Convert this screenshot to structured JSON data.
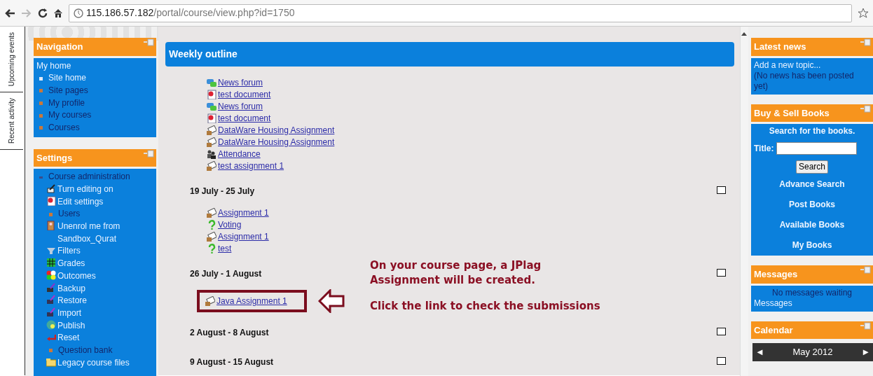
{
  "browser": {
    "url_host": "115.186.57.182",
    "url_path": "/portal/course/view.php?id=1750"
  },
  "side_tabs": [
    {
      "label": "Upcoming events"
    },
    {
      "label": "Recent activity"
    }
  ],
  "navigation": {
    "title": "Navigation",
    "items": [
      {
        "label": "My home",
        "kind": "root"
      },
      {
        "label": "Site home",
        "kind": "leaf"
      },
      {
        "label": "Site pages",
        "kind": "branch"
      },
      {
        "label": "My profile",
        "kind": "branch"
      },
      {
        "label": "My courses",
        "kind": "branch"
      },
      {
        "label": "Courses",
        "kind": "branch"
      }
    ]
  },
  "settings": {
    "title": "Settings",
    "items": [
      {
        "label": "Course administration",
        "kind": "branch",
        "expanded": true,
        "children": [
          {
            "label": "Turn editing on",
            "kind": "editing"
          },
          {
            "label": "Edit settings",
            "kind": "document"
          },
          {
            "label": "Users",
            "kind": "branch"
          },
          {
            "label": "Unenrol me from Sandbox_Qurat",
            "kind": "person"
          },
          {
            "label": "Filters",
            "kind": "filter"
          },
          {
            "label": "Grades",
            "kind": "grades"
          },
          {
            "label": "Outcomes",
            "kind": "outcomes"
          },
          {
            "label": "Backup",
            "kind": "backup"
          },
          {
            "label": "Restore",
            "kind": "restore"
          },
          {
            "label": "Import",
            "kind": "restore"
          },
          {
            "label": "Publish",
            "kind": "publish"
          },
          {
            "label": "Reset",
            "kind": "reset"
          },
          {
            "label": "Question bank",
            "kind": "branch"
          },
          {
            "label": "Legacy course files",
            "kind": "folder"
          }
        ]
      }
    ]
  },
  "course": {
    "title": "Weekly outline",
    "sections": [
      {
        "items": [
          {
            "label": "News forum",
            "kind": "forum",
            "highlighted": false
          },
          {
            "label": "test document",
            "kind": "document",
            "highlighted": false
          },
          {
            "label": "News forum",
            "kind": "forum",
            "highlighted": false
          },
          {
            "label": "test document",
            "kind": "document",
            "highlighted": false
          },
          {
            "label": "DataWare Housing Assignment",
            "kind": "assignment",
            "highlighted": false
          },
          {
            "label": "DataWare Housing Assignment",
            "kind": "assignment",
            "highlighted": false
          },
          {
            "label": "Attendance",
            "kind": "attendance",
            "highlighted": false
          },
          {
            "label": "test assignment 1",
            "kind": "assignment",
            "highlighted": false
          }
        ]
      },
      {
        "title": "19 July - 25 July",
        "items": [
          {
            "label": "Assignment 1",
            "kind": "assignment",
            "highlighted": false
          },
          {
            "label": "Voting",
            "kind": "choice",
            "highlighted": false
          },
          {
            "label": "Assignment 1",
            "kind": "assignment",
            "highlighted": false
          },
          {
            "label": "test",
            "kind": "choice",
            "highlighted": false
          }
        ]
      },
      {
        "title": "26 July - 1 August",
        "items": [
          {
            "label": "Java Assignment 1",
            "kind": "assignment",
            "highlighted": true
          }
        ]
      },
      {
        "title": "2 August - 8 August"
      },
      {
        "title": "9 August - 15 August"
      }
    ],
    "annotation": [
      "On your course page, a JPlag",
      "Assignment will be created.",
      "Click the link to check the submissions"
    ]
  },
  "latest_news": {
    "title": "Latest news",
    "link": "Add a new topic...",
    "note": "(No news has been posted yet)"
  },
  "books": {
    "title": "Buy & Sell Books",
    "heading": "Search for the books.",
    "field_label": "Title:",
    "button": "Search",
    "links": [
      "Advance Search",
      "Post Books",
      "Available Books",
      "My Books"
    ]
  },
  "messages": {
    "title": "Messages",
    "status": "No messages waiting",
    "link": "Messages"
  },
  "calendar": {
    "title": "Calendar",
    "prev": "◄",
    "month": "May 2012",
    "next": "►"
  }
}
